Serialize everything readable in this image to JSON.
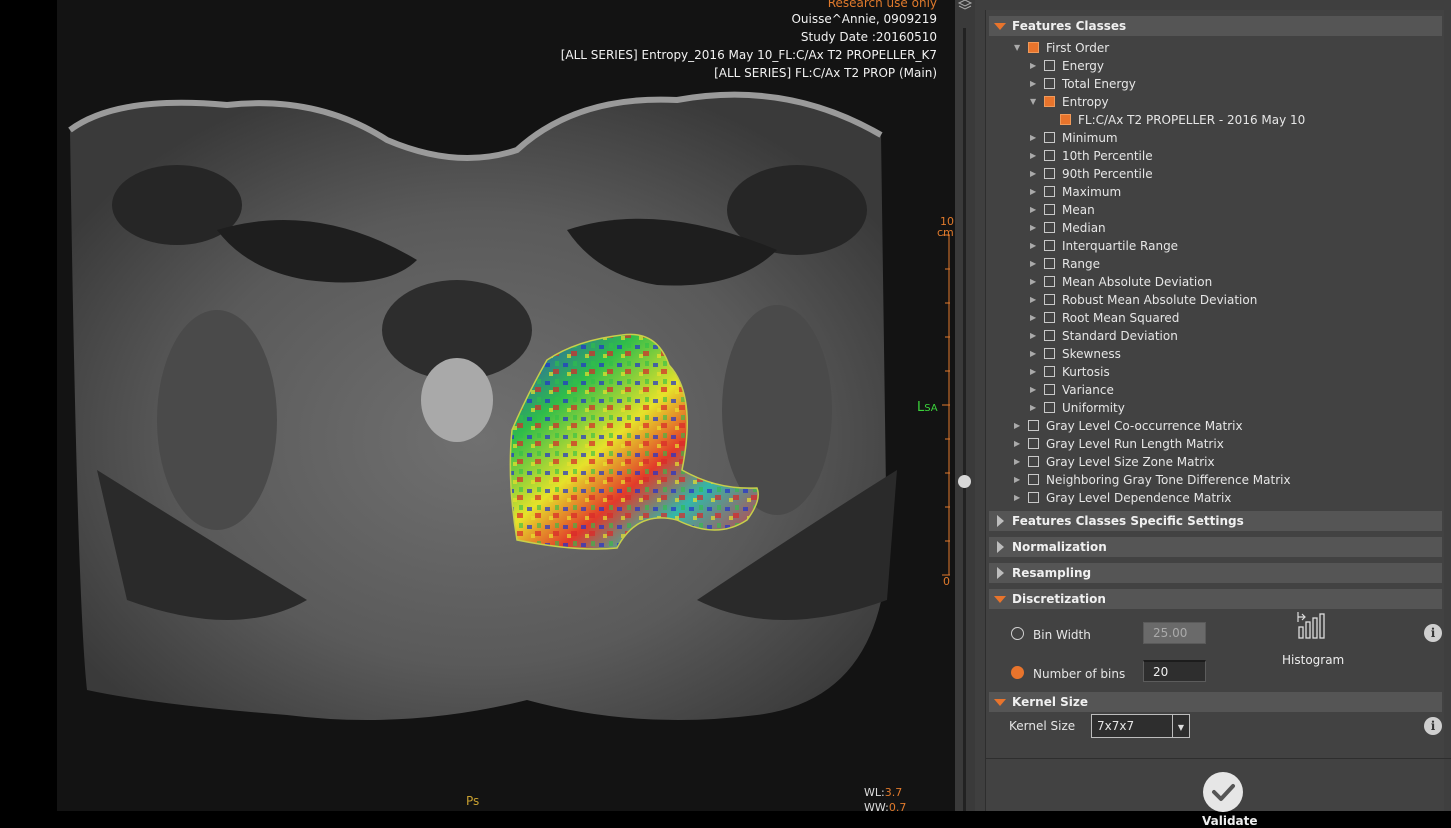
{
  "viewer": {
    "research_label": "Research use only",
    "patient": "Ouisse^Annie, 0909219",
    "study_date": "Study Date :20160510",
    "series_1": "[ALL SERIES] Entropy_2016 May 10_FL:C/Ax T2 PROPELLER_K7",
    "series_2": "[ALL SERIES] FL:C/Ax T2 PROP (Main)",
    "orientation_main": "L",
    "orientation_sub": "SA",
    "ruler_top": "10",
    "ruler_unit": "cm",
    "ruler_bottom": "0",
    "wl_label": "WL:",
    "wl_value": "3.7",
    "ww_label": "WW:",
    "ww_value": "0.7",
    "bottom_orientation": "Ps"
  },
  "panel": {
    "features_classes": {
      "label": "Features Classes",
      "first_order": {
        "label": "First Order",
        "items": [
          {
            "label": "Energy"
          },
          {
            "label": "Total Energy"
          },
          {
            "label": "Entropy",
            "child": "FL:C/Ax T2 PROPELLER - 2016 May 10"
          },
          {
            "label": "Minimum"
          },
          {
            "label": "10th Percentile"
          },
          {
            "label": "90th Percentile"
          },
          {
            "label": "Maximum"
          },
          {
            "label": "Mean"
          },
          {
            "label": "Median"
          },
          {
            "label": "Interquartile Range"
          },
          {
            "label": "Range"
          },
          {
            "label": "Mean Absolute Deviation"
          },
          {
            "label": "Robust Mean Absolute Deviation"
          },
          {
            "label": "Root Mean Squared"
          },
          {
            "label": "Standard Deviation"
          },
          {
            "label": "Skewness"
          },
          {
            "label": "Kurtosis"
          },
          {
            "label": "Variance"
          },
          {
            "label": "Uniformity"
          }
        ]
      },
      "matrices": [
        "Gray Level Co-occurrence Matrix",
        "Gray Level Run Length Matrix",
        "Gray Level Size Zone Matrix",
        "Neighboring Gray Tone Difference Matrix",
        "Gray Level Dependence Matrix"
      ]
    },
    "sections": {
      "specific_settings": "Features Classes Specific Settings",
      "normalization": "Normalization",
      "resampling": "Resampling",
      "discretization": "Discretization",
      "kernel_size": "Kernel Size"
    },
    "discretization": {
      "bin_width_label": "Bin Width",
      "bin_width_value": "25.00",
      "number_of_bins_label": "Number of bins",
      "number_of_bins_value": "20",
      "histogram_label": "Histogram"
    },
    "kernel": {
      "label": "Kernel Size",
      "value": "7x7x7"
    },
    "validate_label": "Validate"
  },
  "colors": {
    "accent": "#e8742c",
    "panel_bg": "#424242",
    "header_bg": "#555555"
  }
}
